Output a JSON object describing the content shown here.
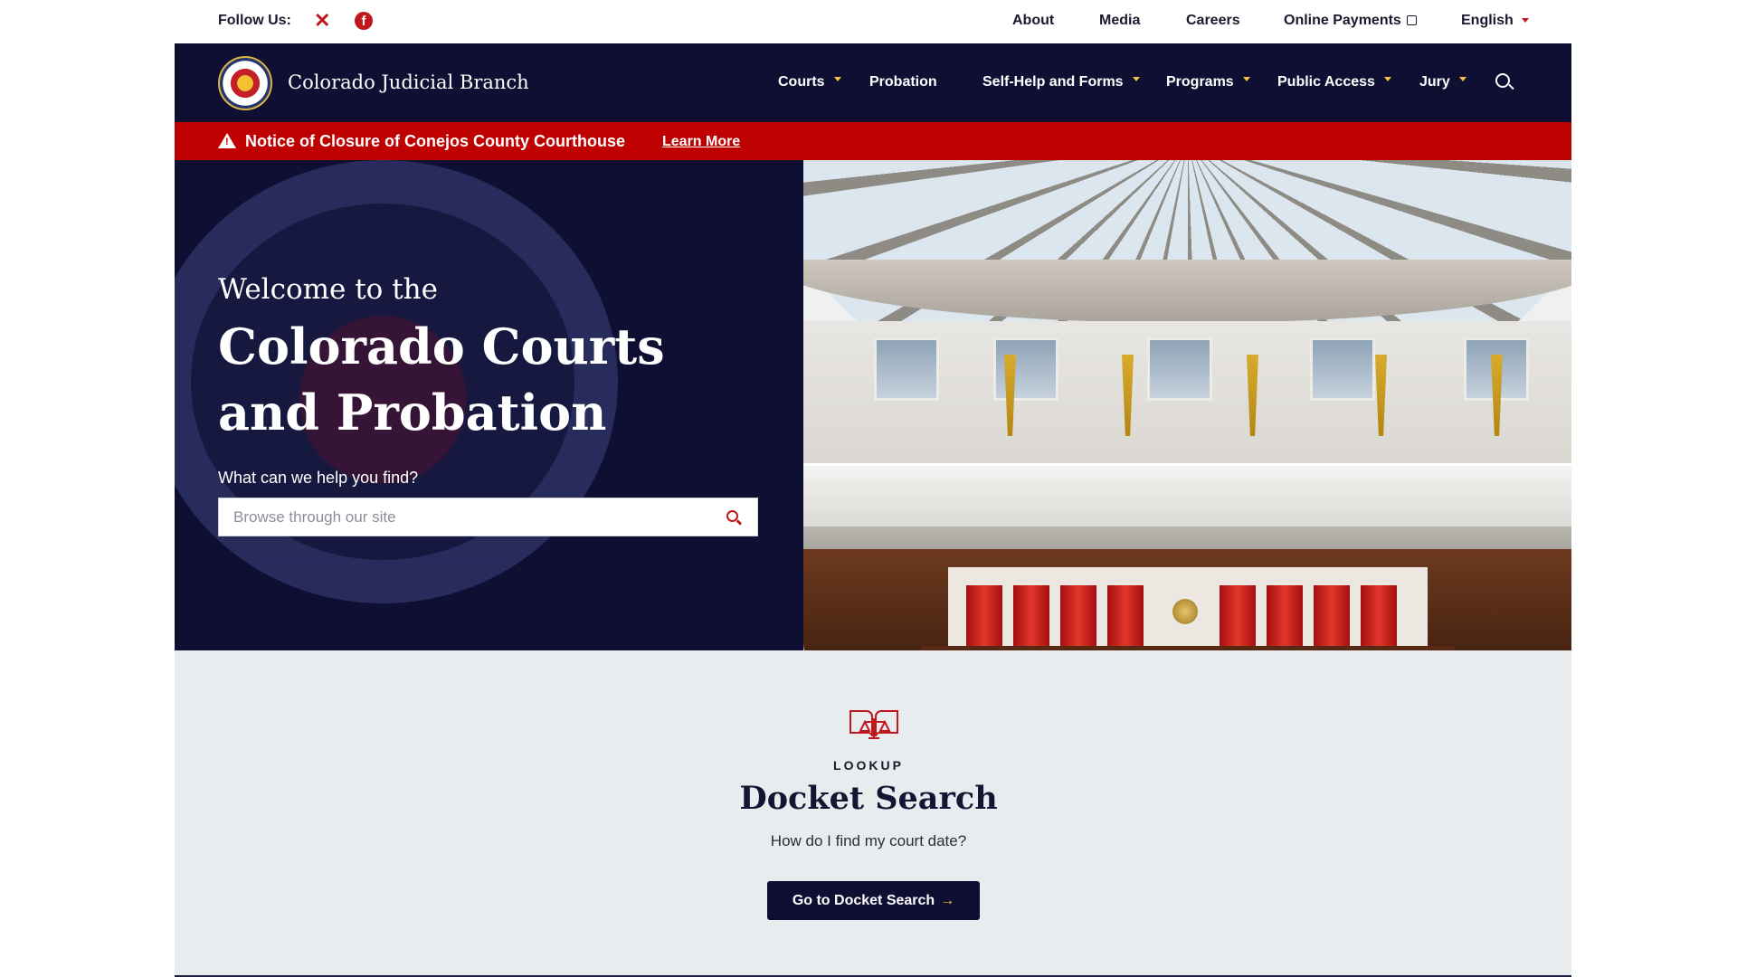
{
  "topbar": {
    "follow_label": "Follow Us:",
    "social": [
      "x-icon",
      "facebook-icon"
    ],
    "links": [
      "About",
      "Media",
      "Careers",
      "Online Payments",
      "English"
    ]
  },
  "nav": {
    "brand": "Colorado Judicial Branch",
    "items": [
      "Courts",
      "Probation",
      "Self-Help and Forms",
      "Programs",
      "Public Access",
      "Jury"
    ]
  },
  "alert": {
    "text": "Notice of Closure of Conejos County Courthouse",
    "link": "Learn More"
  },
  "hero": {
    "welcome": "Welcome to the",
    "title": "Colorado Courts and Probation",
    "question": "What can we help you find?",
    "search_placeholder": "Browse through our site"
  },
  "docket": {
    "eyebrow": "LOOKUP",
    "title": "Docket Search",
    "subtitle": "How do I find my court date?",
    "button": "Go to Docket Search"
  },
  "colors": {
    "navy": "#0f0e33",
    "alert_red": "#bf0000",
    "accent_red": "#c0171c",
    "accent_yellow": "#f5c242",
    "section_gray": "#e9ecef"
  }
}
